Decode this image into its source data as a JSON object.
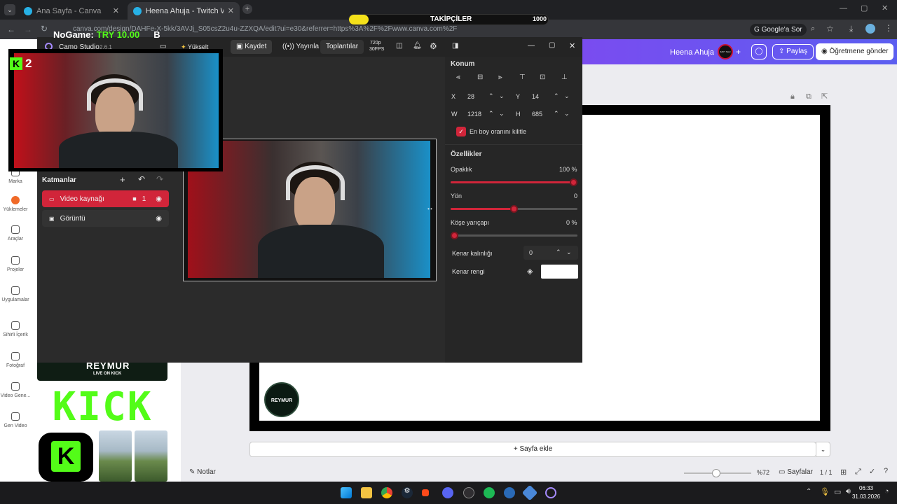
{
  "browser": {
    "tabs": [
      {
        "title": "Ana Sayfa - Canva",
        "active": false
      },
      {
        "title": "Heena Ahuja - Twitch Web Kam",
        "active": true
      }
    ],
    "url": "canva.com/design/DAHFe-X-5kk/3AVJj_S05csZ2u4u-ZZXQA/edit?ui=e30&referrer=https%3A%2F%2Fwww.canva.com%2F",
    "google_ask": "Google'a Sor"
  },
  "overlay": {
    "nogame_label": "NoGame:",
    "nogame_value": "TRY 10.00",
    "nogame_suffix": "B",
    "followers_label": "TAKİPÇİLER",
    "followers_goal": "1000",
    "followers_progress": 0.06,
    "kick_count": "2"
  },
  "canva_header": {
    "user": "Heena Ahuja",
    "avatar_text": "ZAVY SALI",
    "share": "Paylaş",
    "send_teacher": "Öğretmene gönder"
  },
  "canva_rail": [
    {
      "label": "Marka",
      "icon": "brand-icon"
    },
    {
      "label": "Yüklemeler",
      "icon": "upload-icon"
    },
    {
      "label": "Araçlar",
      "icon": "tools-icon"
    },
    {
      "label": "Projeler",
      "icon": "folder-icon"
    },
    {
      "label": "Uygulamalar",
      "icon": "apps-icon"
    },
    {
      "label": "Sihirli İçerik",
      "icon": "magic-icon"
    },
    {
      "label": "Fotoğraf",
      "icon": "photo-icon"
    },
    {
      "label": "Video Gene...",
      "icon": "video-gen-icon"
    },
    {
      "label": "Gen Video",
      "icon": "gen-video-icon"
    }
  ],
  "canva_bottom": {
    "add_page": "+ Sayfa ekle",
    "notes": "Notlar",
    "zoom": "%72",
    "pages": "Sayfalar",
    "page_count": "1 / 1"
  },
  "thumbnails": {
    "reymur": "REYMUR",
    "live_on_kick": "LIVE ON KICK",
    "kick": "KICK"
  },
  "camo": {
    "title": "Camo Studio",
    "version": "2.6.1",
    "upgrade": "Yükselt",
    "record": "Kaydet",
    "broadcast": "Yayınla",
    "meetings": "Toplantılar",
    "resolution": "720p",
    "fps": "30FPS",
    "layers_title": "Katmanlar",
    "layers": [
      {
        "name": "Video kaynağı",
        "badge": "1",
        "active": true
      },
      {
        "name": "Görüntü",
        "badge": "",
        "active": false
      }
    ],
    "position": {
      "title": "Konum",
      "x_label": "X",
      "x": "28",
      "y_label": "Y",
      "y": "14",
      "w_label": "W",
      "w": "1218",
      "h_label": "H",
      "h": "685",
      "lock_ratio": "En boy oranını kilitle"
    },
    "properties": {
      "title": "Özellikler",
      "opacity_label": "Opaklık",
      "opacity": "100 %",
      "opacity_level": 1.0,
      "direction_label": "Yön",
      "direction": "0",
      "direction_level": 0.5,
      "corner_label": "Köşe yarıçapı",
      "corner": "0 %",
      "corner_level": 0.0,
      "border_width_label": "Kenar kalınlığı",
      "border_width": "0",
      "border_color_label": "Kenar rengi",
      "border_color": "#ffffff"
    }
  },
  "colors": {
    "accent_red": "#d1253a",
    "kick_green": "#53fc18",
    "canva_purple": "#7a4cf0"
  },
  "taskbar": {
    "time": "06:33",
    "date": "31.03.2026"
  },
  "logo": "REYMUR"
}
